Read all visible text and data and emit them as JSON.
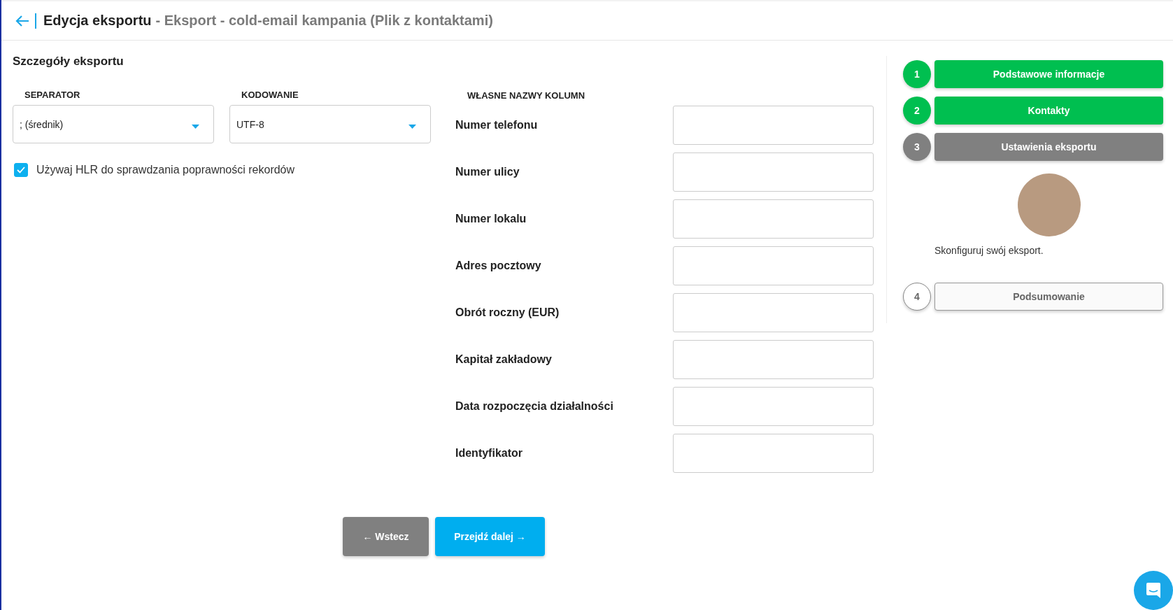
{
  "header": {
    "title": "Edycja eksportu",
    "subtitle": "- Eksport - cold-email kampania (Plik z kontaktami)"
  },
  "details": {
    "heading": "Szczegóły eksportu",
    "selects": [
      {
        "label": "SEPARATOR",
        "value": "; (średnik)"
      },
      {
        "label": "KODOWANIE",
        "value": "UTF-8"
      }
    ],
    "hlr": {
      "label": "Używaj HLR do sprawdzania poprawności rekordów",
      "checked": true
    }
  },
  "columns": {
    "heading": "WŁASNE NAZWY KOLUMN",
    "rows": [
      {
        "label": "Numer telefonu"
      },
      {
        "label": "Numer ulicy"
      },
      {
        "label": "Numer lokalu"
      },
      {
        "label": "Adres pocztowy"
      },
      {
        "label": "Obrót roczny (EUR)"
      },
      {
        "label": "Kapitał zakładowy"
      },
      {
        "label": "Data rozpoczęcia działalności"
      },
      {
        "label": "Identyfikator"
      }
    ]
  },
  "buttons": {
    "back": "← Wstecz",
    "next": "Przejdź dalej →"
  },
  "steps": [
    {
      "number": "1",
      "label": "Podstawowe informacje",
      "completed": true,
      "selected": false
    },
    {
      "number": "2",
      "label": "Kontakty",
      "completed": true,
      "selected": false
    },
    {
      "number": "3",
      "label": "Ustawienia eksportu",
      "completed": false,
      "selected": true,
      "message": "Skonfiguruj swój eksport."
    },
    {
      "number": "4",
      "label": "Podsumowanie",
      "completed": false,
      "selected": false
    }
  ]
}
